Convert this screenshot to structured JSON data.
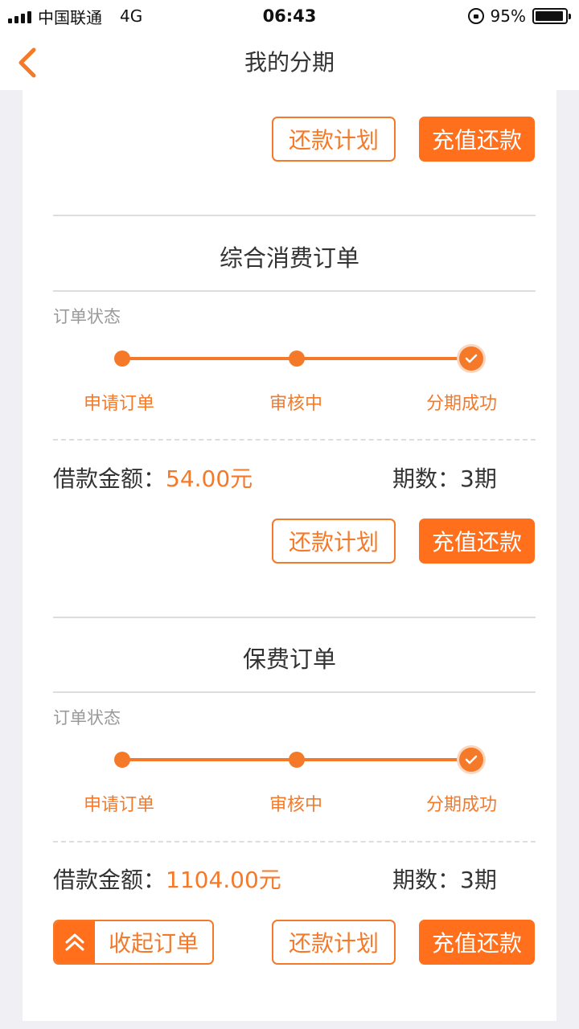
{
  "status_bar": {
    "carrier": "中国联通",
    "network": "4G",
    "time": "06:43",
    "battery": "95%"
  },
  "nav": {
    "title": "我的分期"
  },
  "top_actions": {
    "plan_label": "还款计划",
    "recharge_label": "充值还款"
  },
  "orders": [
    {
      "title": "综合消费订单",
      "status_label": "订单状态",
      "steps": [
        "申请订单",
        "审核中",
        "分期成功"
      ],
      "amount_label": "借款金额：",
      "amount_value": "54.00元",
      "periods": "期数：3期",
      "plan_label": "还款计划",
      "recharge_label": "充值还款"
    },
    {
      "title": "保费订单",
      "status_label": "订单状态",
      "steps": [
        "申请订单",
        "审核中",
        "分期成功"
      ],
      "amount_label": "借款金额：",
      "amount_value": "1104.00元",
      "periods": "期数：3期",
      "collapse_label": "收起订单",
      "plan_label": "还款计划",
      "recharge_label": "充值还款"
    }
  ],
  "colors": {
    "accent": "#f47a2a",
    "button_solid": "#ff6f1c",
    "background": "#efeff4"
  }
}
